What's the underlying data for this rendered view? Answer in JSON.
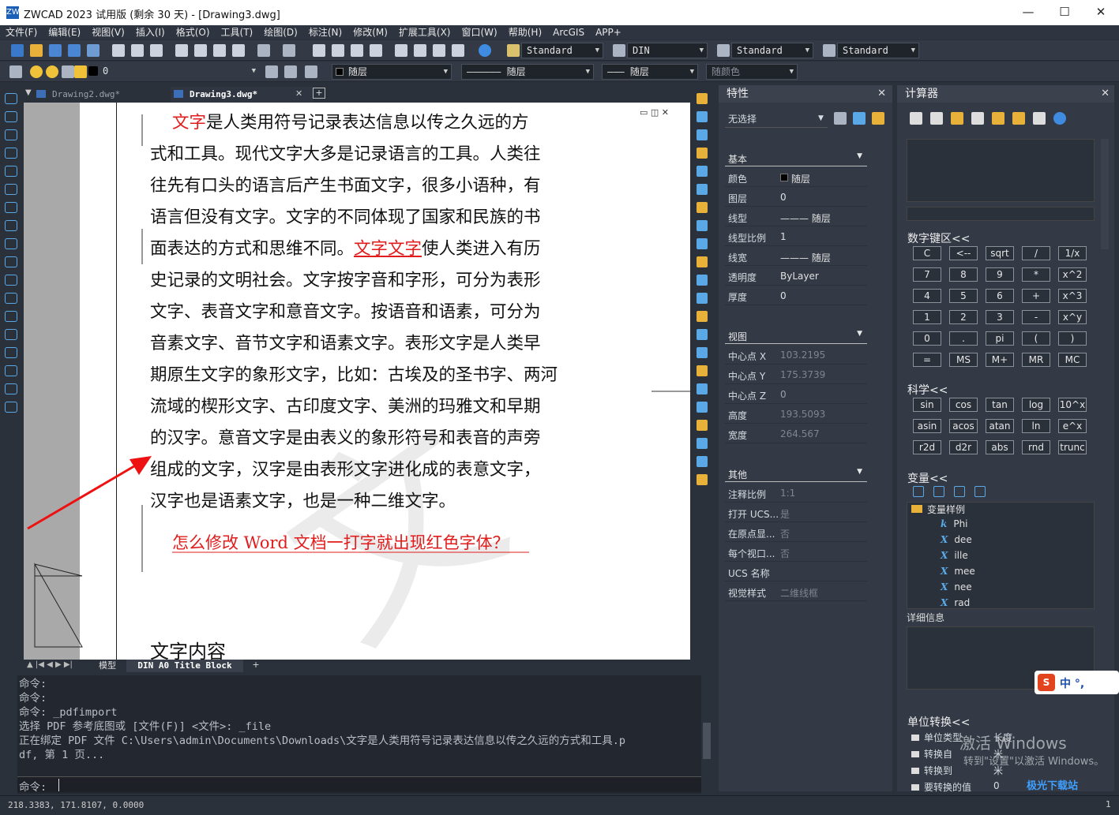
{
  "window": {
    "title": "ZWCAD 2023 试用版 (剩余 30 天) - [Drawing3.dwg]",
    "logo": "ZW",
    "minimize": "—",
    "maximize": "☐",
    "close": "✕"
  },
  "menu": [
    "文件(F)",
    "编辑(E)",
    "视图(V)",
    "插入(I)",
    "格式(O)",
    "工具(T)",
    "绘图(D)",
    "标注(N)",
    "修改(M)",
    "扩展工具(X)",
    "窗口(W)",
    "帮助(H)",
    "ArcGIS",
    "APP+"
  ],
  "toolbar": {
    "textstyle": "Standard",
    "dimstyle": "DIN",
    "tablestyle": "Standard",
    "multileader": "Standard",
    "layer": "0",
    "color": "随层",
    "linetype": "—————— 随层",
    "lineweight": "——— 随层",
    "plotstyle": "随颜色"
  },
  "tabs": {
    "drawing2": "Drawing2.dwg*",
    "drawing3": "Drawing3.dwg*"
  },
  "document": {
    "lines": [
      "文字是人类用符号记录表达信息以传之久远的方",
      "式和工具。现代文字大多是记录语言的工具。人类往",
      "往先有口头的语言后产生书面文字，很多小语种，有",
      "语言但没有文字。文字的不同体现了国家和民族的书",
      "面表达的方式和思维不同。文字文字使人类进入有历",
      "史记录的文明社会。文字按字音和字形，可分为表形",
      "文字、表音文字和意音文字。按语音和语素，可分为",
      "音素文字、音节文字和语素文字。表形文字是人类早",
      "期原生文字的象形文字，比如：古埃及的圣书字、两河",
      "流域的楔形文字、古印度文字、美洲的玛雅文和早期",
      "的汉字。意音文字是由表义的象形符号和表音的声旁",
      "组成的文字，汉字是由表形文字进化成的表意文字，",
      "汉字也是语素文字，也是一种二维文字。"
    ],
    "red_heading": "怎么修改 Word 文档一打字就出现红色字体？",
    "bottom_label": "文字内容"
  },
  "layout_tabs": {
    "model": "模型",
    "layout": "DIN A0 Title Block",
    "add": "+"
  },
  "command": {
    "history": [
      "命令:",
      "命令:",
      "命令: _pdfimport",
      "选择 PDF 参考底图或 [文件(F)] <文件>: _file",
      "正在绑定 PDF 文件 C:\\Users\\admin\\Documents\\Downloads\\文字是人类用符号记录表达信息以传之久远的方式和工具.p",
      "df, 第 1 页..."
    ],
    "prompt": "命令:"
  },
  "status": {
    "coords": "218.3383, 171.8107, 0.0000"
  },
  "properties": {
    "title": "特性",
    "selection": "无选择",
    "basic": {
      "title": "基本",
      "rows": [
        [
          "颜色",
          "随层"
        ],
        [
          "图层",
          "0"
        ],
        [
          "线型",
          "——— 随层"
        ],
        [
          "线型比例",
          "1"
        ],
        [
          "线宽",
          "——— 随层"
        ],
        [
          "透明度",
          "ByLayer"
        ],
        [
          "厚度",
          "0"
        ]
      ]
    },
    "view": {
      "title": "视图",
      "rows": [
        [
          "中心点 X",
          "103.2195"
        ],
        [
          "中心点 Y",
          "175.3739"
        ],
        [
          "中心点 Z",
          "0"
        ],
        [
          "高度",
          "193.5093"
        ],
        [
          "宽度",
          "264.567"
        ]
      ]
    },
    "other": {
      "title": "其他",
      "rows": [
        [
          "注释比例",
          "1:1"
        ],
        [
          "打开 UCS...",
          "是"
        ],
        [
          "在原点显...",
          "否"
        ],
        [
          "每个视口...",
          "否"
        ],
        [
          "UCS 名称",
          ""
        ],
        [
          "视觉样式",
          "二维线框"
        ]
      ]
    }
  },
  "calculator": {
    "title": "计算器",
    "keypad_title": "数字键区<<",
    "keys": [
      [
        "C",
        "<--",
        "sqrt",
        "/",
        "1/x"
      ],
      [
        "7",
        "8",
        "9",
        "*",
        "x^2"
      ],
      [
        "4",
        "5",
        "6",
        "+",
        "x^3"
      ],
      [
        "1",
        "2",
        "3",
        "-",
        "x^y"
      ],
      [
        "0",
        ".",
        "pi",
        "(",
        ")"
      ],
      [
        "=",
        "MS",
        "M+",
        "MR",
        "MC"
      ]
    ],
    "sci_title": "科学<<",
    "sci": [
      [
        "sin",
        "cos",
        "tan",
        "log",
        "10^x"
      ],
      [
        "asin",
        "acos",
        "atan",
        "ln",
        "e^x"
      ],
      [
        "r2d",
        "d2r",
        "abs",
        "rnd",
        "trunc"
      ]
    ],
    "var_title": "变量<<",
    "var_folder": "变量样例",
    "vars": [
      [
        "k",
        "Phi"
      ],
      [
        "X",
        "dee"
      ],
      [
        "X",
        "ille"
      ],
      [
        "X",
        "mee"
      ],
      [
        "X",
        "nee"
      ],
      [
        "X",
        "rad"
      ]
    ],
    "detail": "详细信息",
    "unit_title": "单位转换<<",
    "units": [
      [
        "单位类型",
        "长度"
      ],
      [
        "转换自",
        "米"
      ],
      [
        "转换到",
        "米"
      ],
      [
        "要转换的值",
        "0"
      ]
    ]
  },
  "overlay": {
    "activate": "激活 Windows",
    "activate_sub": "转到\"设置\"以激活 Windows。",
    "ime": "中 °,",
    "watermark": "极光下载站"
  }
}
